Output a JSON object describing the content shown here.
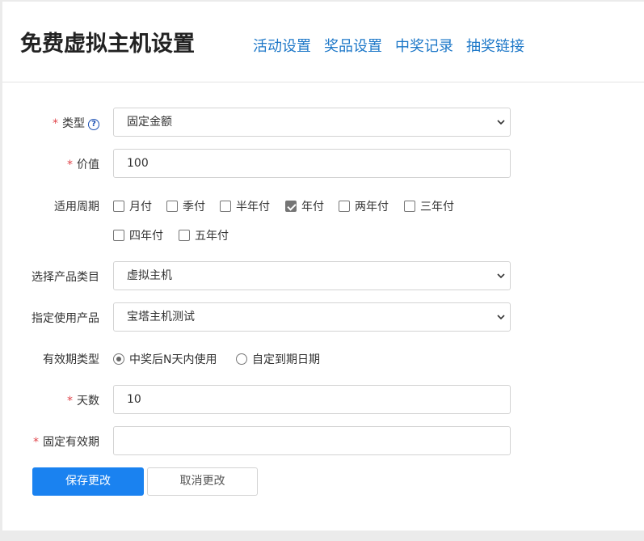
{
  "header": {
    "title": "免费虚拟主机设置",
    "nav": [
      "活动设置",
      "奖品设置",
      "中奖记录",
      "抽奖链接"
    ]
  },
  "form": {
    "type": {
      "label": "类型",
      "required": true,
      "help": "?",
      "value": "固定金额"
    },
    "value": {
      "label": "价值",
      "required": true,
      "value": "100"
    },
    "period": {
      "label": "适用周期",
      "options": [
        {
          "label": "月付",
          "checked": false
        },
        {
          "label": "季付",
          "checked": false
        },
        {
          "label": "半年付",
          "checked": false
        },
        {
          "label": "年付",
          "checked": true
        },
        {
          "label": "两年付",
          "checked": false
        },
        {
          "label": "三年付",
          "checked": false
        },
        {
          "label": "四年付",
          "checked": false
        },
        {
          "label": "五年付",
          "checked": false
        }
      ]
    },
    "category": {
      "label": "选择产品类目",
      "value": "虚拟主机"
    },
    "product": {
      "label": "指定使用产品",
      "value": "宝塔主机测试"
    },
    "validity_type": {
      "label": "有效期类型",
      "options": [
        {
          "label": "中奖后N天内使用",
          "checked": true
        },
        {
          "label": "自定到期日期",
          "checked": false
        }
      ]
    },
    "days": {
      "label": "天数",
      "required": true,
      "value": "10"
    },
    "fixed_expiry": {
      "label": "固定有效期",
      "required": true,
      "value": ""
    }
  },
  "buttons": {
    "save": "保存更改",
    "cancel": "取消更改"
  },
  "required_mark": "*",
  "colors": {
    "primary": "#1a82f0",
    "link": "#1e78c8",
    "required": "#e0454b"
  }
}
